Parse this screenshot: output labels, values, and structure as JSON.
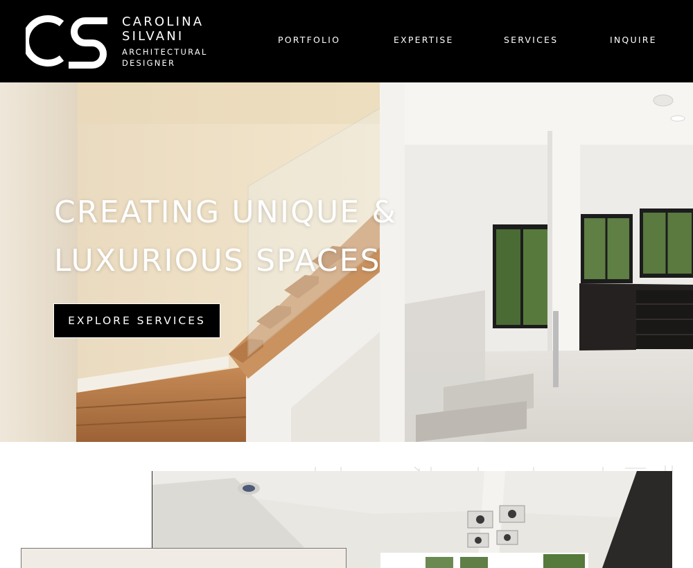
{
  "header": {
    "logo": {
      "monogram": "CS",
      "name_line1": "CAROLINA",
      "name_line2": "SILVANI",
      "role_line1": "ARCHITECTURAL",
      "role_line2": "DESIGNER"
    },
    "nav": [
      {
        "label": "PORTFOLIO"
      },
      {
        "label": "EXPERTISE"
      },
      {
        "label": "SERVICES"
      },
      {
        "label": "INQUIRE"
      }
    ]
  },
  "hero": {
    "title_line1": "CREATING UNIQUE &",
    "title_line2": "LUXURIOUS SPACES",
    "cta_label": "EXPLORE SERVICES"
  },
  "colors": {
    "header_bg": "#000000",
    "header_text": "#ffffff",
    "cta_bg": "#000000",
    "card_bg": "#f0ece5"
  }
}
